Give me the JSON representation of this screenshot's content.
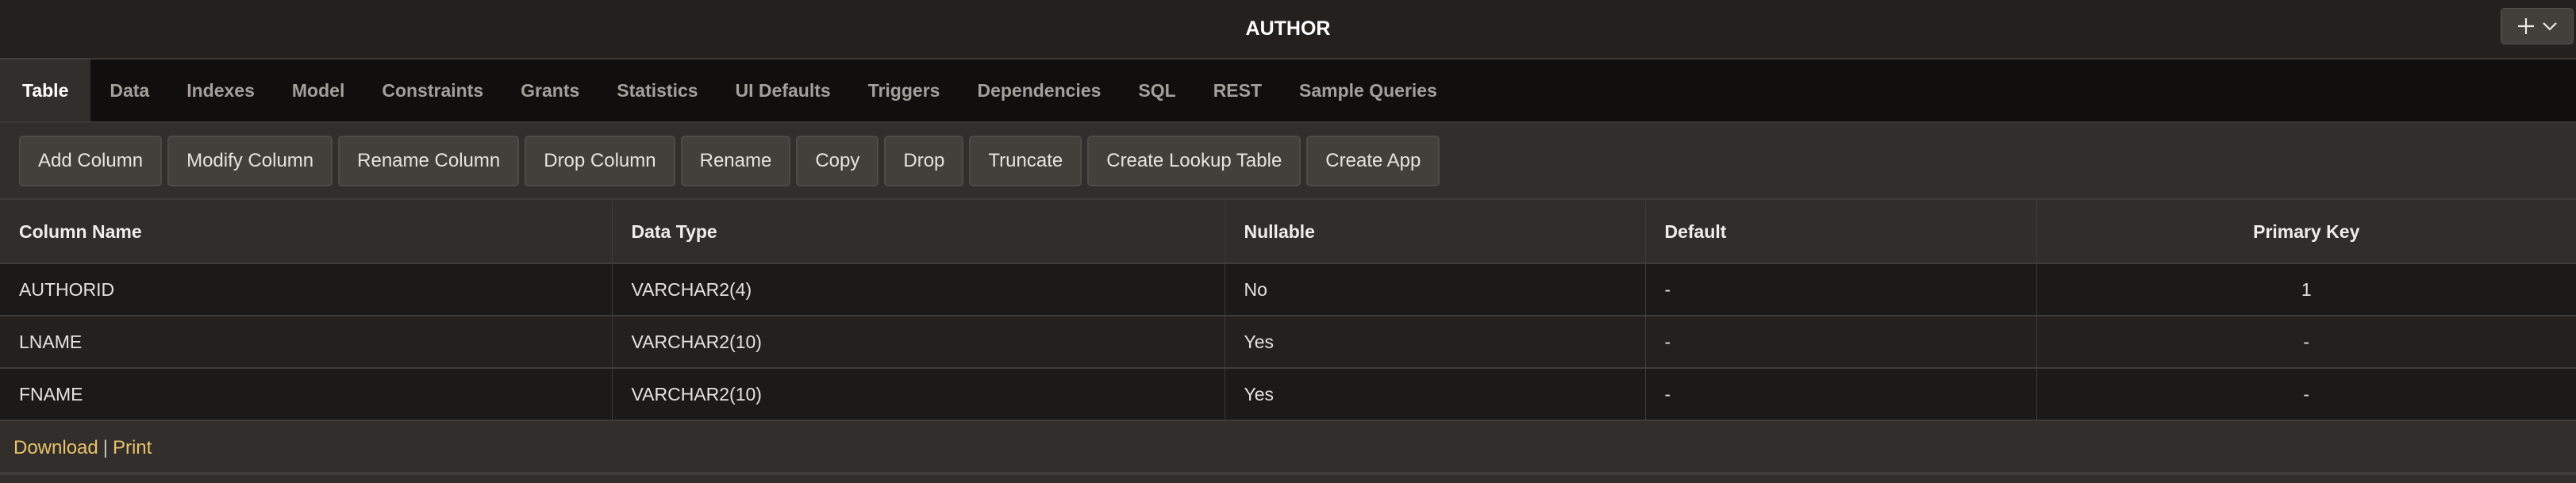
{
  "header": {
    "title": "AUTHOR",
    "add_menu_icon": "plus-icon",
    "add_menu_chevron_icon": "chevron-down-icon"
  },
  "tabs": [
    {
      "label": "Table",
      "active": true
    },
    {
      "label": "Data",
      "active": false
    },
    {
      "label": "Indexes",
      "active": false
    },
    {
      "label": "Model",
      "active": false
    },
    {
      "label": "Constraints",
      "active": false
    },
    {
      "label": "Grants",
      "active": false
    },
    {
      "label": "Statistics",
      "active": false
    },
    {
      "label": "UI Defaults",
      "active": false
    },
    {
      "label": "Triggers",
      "active": false
    },
    {
      "label": "Dependencies",
      "active": false
    },
    {
      "label": "SQL",
      "active": false
    },
    {
      "label": "REST",
      "active": false
    },
    {
      "label": "Sample Queries",
      "active": false
    }
  ],
  "toolbar": {
    "buttons": [
      "Add Column",
      "Modify Column",
      "Rename Column",
      "Drop Column",
      "Rename",
      "Copy",
      "Drop",
      "Truncate",
      "Create Lookup Table",
      "Create App"
    ]
  },
  "table": {
    "columns": [
      "Column Name",
      "Data Type",
      "Nullable",
      "Default",
      "Primary Key"
    ],
    "rows": [
      [
        "AUTHORID",
        "VARCHAR2(4)",
        "No",
        "-",
        "1"
      ],
      [
        "LNAME",
        "VARCHAR2(10)",
        "Yes",
        "-",
        "-"
      ],
      [
        "FNAME",
        "VARCHAR2(10)",
        "Yes",
        "-",
        "-"
      ]
    ]
  },
  "footer": {
    "download_label": "Download",
    "separator": "|",
    "print_label": "Print"
  },
  "colors": {
    "link": "#e9c26c",
    "active_tab_bg": "#322e2b",
    "tab_bar_bg": "#110f0e"
  }
}
